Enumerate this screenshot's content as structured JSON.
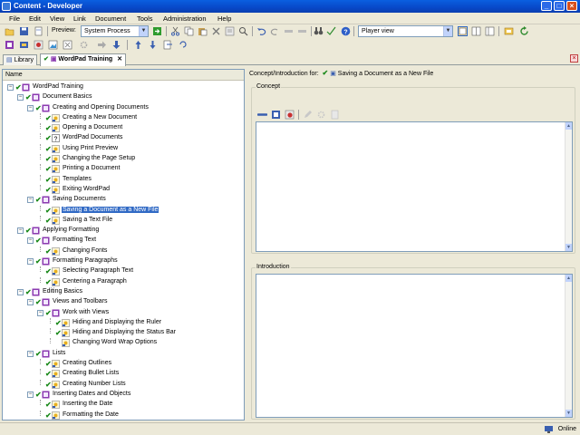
{
  "window": {
    "title": "Content - Developer"
  },
  "menu": [
    "File",
    "Edit",
    "View",
    "Link",
    "Document",
    "Tools",
    "Administration",
    "Help"
  ],
  "toolbar": {
    "preview_label": "Preview:",
    "preview_value": "System Process",
    "view_value": "Player view"
  },
  "tabs": [
    {
      "label": "Library",
      "active": false
    },
    {
      "label": "WordPad Training",
      "active": true
    }
  ],
  "tree": {
    "column_header": "Name",
    "selected": "Saving a Document as a New File",
    "items": [
      {
        "label": "WordPad Training",
        "level": 0,
        "expander": "-",
        "icon": "book-icon"
      },
      {
        "label": "Document Basics",
        "level": 1,
        "expander": "-",
        "icon": "book-icon"
      },
      {
        "label": "Creating and Opening Documents",
        "level": 2,
        "expander": "-",
        "icon": "book-icon"
      },
      {
        "label": "Creating a New Document",
        "level": 3,
        "icon": "topic-icon"
      },
      {
        "label": "Opening a Document",
        "level": 3,
        "icon": "topic-icon"
      },
      {
        "label": "WordPad Documents",
        "level": 3,
        "icon": "question-icon"
      },
      {
        "label": "Using Print Preview",
        "level": 3,
        "icon": "topic-icon"
      },
      {
        "label": "Changing the Page Setup",
        "level": 3,
        "icon": "topic-icon"
      },
      {
        "label": "Printing a Document",
        "level": 3,
        "icon": "topic-icon"
      },
      {
        "label": "Templates",
        "level": 3,
        "icon": "topic-icon"
      },
      {
        "label": "Exiting WordPad",
        "level": 3,
        "icon": "topic-icon"
      },
      {
        "label": "Saving Documents",
        "level": 2,
        "expander": "-",
        "icon": "book-icon"
      },
      {
        "label": "Saving a Document as a New File",
        "level": 3,
        "icon": "topic-icon"
      },
      {
        "label": "Saving a Text File",
        "level": 3,
        "icon": "topic-icon"
      },
      {
        "label": "Applying Formatting",
        "level": 1,
        "expander": "-",
        "icon": "book-icon"
      },
      {
        "label": "Formatting Text",
        "level": 2,
        "expander": "-",
        "icon": "book-icon"
      },
      {
        "label": "Changing Fonts",
        "level": 3,
        "icon": "topic-icon"
      },
      {
        "label": "Formatting Paragraphs",
        "level": 2,
        "expander": "-",
        "icon": "book-icon"
      },
      {
        "label": "Selecting Paragraph Text",
        "level": 3,
        "icon": "topic-icon"
      },
      {
        "label": "Centering a Paragraph",
        "level": 3,
        "icon": "topic-icon"
      },
      {
        "label": "Editing Basics",
        "level": 1,
        "expander": "-",
        "icon": "book-icon"
      },
      {
        "label": "Views and Toolbars",
        "level": 2,
        "expander": "-",
        "icon": "book-icon"
      },
      {
        "label": "Work with Views",
        "level": 3,
        "expander": "-",
        "icon": "book-icon"
      },
      {
        "label": "Hiding and Displaying the Ruler",
        "level": 4,
        "icon": "topic-icon"
      },
      {
        "label": "Hiding and Displaying the Status Bar",
        "level": 4,
        "icon": "topic-icon"
      },
      {
        "label": "Changing Word Wrap Options",
        "level": 4,
        "icon": "topic-icon",
        "nocheck": true
      },
      {
        "label": "Lists",
        "level": 2,
        "expander": "-",
        "icon": "book-icon"
      },
      {
        "label": "Creating Outlines",
        "level": 3,
        "icon": "topic-icon"
      },
      {
        "label": "Creating Bullet Lists",
        "level": 3,
        "icon": "topic-icon"
      },
      {
        "label": "Creating Number Lists",
        "level": 3,
        "icon": "topic-icon"
      },
      {
        "label": "Inserting Dates and Objects",
        "level": 2,
        "expander": "-",
        "icon": "book-icon"
      },
      {
        "label": "Inserting the Date",
        "level": 3,
        "icon": "topic-icon"
      },
      {
        "label": "Formatting the Date",
        "level": 3,
        "icon": "topic-icon"
      }
    ]
  },
  "detail": {
    "context_label": "Concept/Introduction for:",
    "context_item": "Saving a Document as a New File",
    "concept_label": "Concept",
    "introduction_label": "Introduction"
  },
  "status": {
    "connection": "Online"
  },
  "colors": {
    "selection": "#316AC5",
    "check": "#1C8A1C",
    "titlebar": "#0A5FE0"
  }
}
